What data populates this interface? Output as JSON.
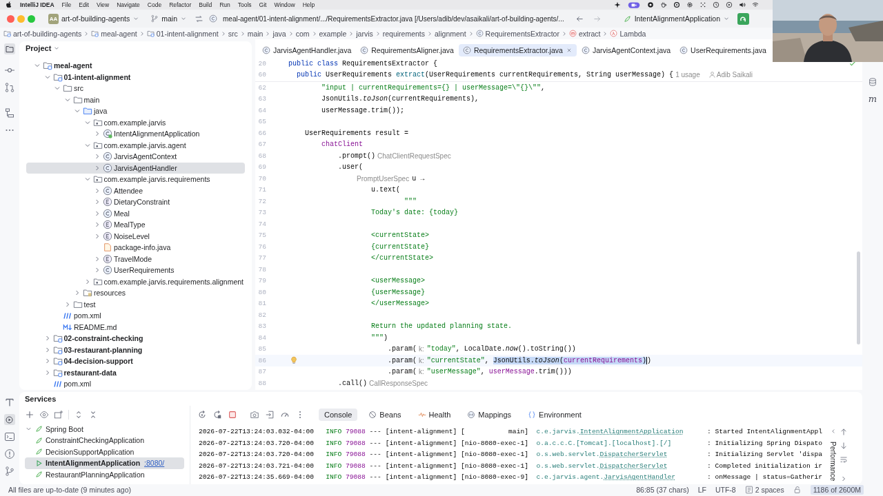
{
  "menubar": {
    "app": "IntelliJ IDEA",
    "menus": [
      "File",
      "Edit",
      "View",
      "Navigate",
      "Code",
      "Refactor",
      "Build",
      "Run",
      "Tools",
      "Git",
      "Window",
      "Help"
    ]
  },
  "titlebar": {
    "project_initials": "AA",
    "project": "art-of-building-agents",
    "branch": "main",
    "title": "meal-agent/01-intent-alignment/.../RequirementsExtractor.java [/Users/adib/dev/asaikali/art-of-building-agents/...",
    "run_config": "IntentAlignmentApplication"
  },
  "breadcrumbs": [
    {
      "label": "art-of-building-agents",
      "kind": "module"
    },
    {
      "label": "meal-agent",
      "kind": "module"
    },
    {
      "label": "01-intent-alignment",
      "kind": "module"
    },
    {
      "label": "src",
      "kind": "plain"
    },
    {
      "label": "main",
      "kind": "plain"
    },
    {
      "label": "java",
      "kind": "plain"
    },
    {
      "label": "com",
      "kind": "plain"
    },
    {
      "label": "example",
      "kind": "plain"
    },
    {
      "label": "jarvis",
      "kind": "plain"
    },
    {
      "label": "requirements",
      "kind": "plain"
    },
    {
      "label": "alignment",
      "kind": "plain"
    },
    {
      "label": "RequirementsExtractor",
      "kind": "class"
    },
    {
      "label": "extract",
      "kind": "method"
    },
    {
      "label": "Lambda",
      "kind": "lambda"
    }
  ],
  "project": {
    "title": "Project",
    "tree": [
      {
        "label": "meal-agent",
        "kind": "module",
        "expanded": true,
        "selected": false,
        "children": [
          {
            "label": "01-intent-alignment",
            "kind": "module",
            "expanded": true,
            "selected": false,
            "children": [
              {
                "label": "src",
                "kind": "folder",
                "expanded": true,
                "selected": false,
                "children": [
                  {
                    "label": "main",
                    "kind": "folder",
                    "expanded": true,
                    "selected": false,
                    "children": [
                      {
                        "label": "java",
                        "kind": "source",
                        "expanded": true,
                        "selected": false,
                        "children": [
                          {
                            "label": "com.example.jarvis",
                            "kind": "package",
                            "expanded": true,
                            "selected": false,
                            "children": [
                              {
                                "label": "IntentAlignmentApplication",
                                "kind": "spring",
                                "expanded": false,
                                "selected": false
                              }
                            ]
                          },
                          {
                            "label": "com.example.jarvis.agent",
                            "kind": "package",
                            "expanded": true,
                            "selected": false,
                            "children": [
                              {
                                "label": "JarvisAgentContext",
                                "kind": "class",
                                "expanded": false,
                                "selected": false
                              },
                              {
                                "label": "JarvisAgentHandler",
                                "kind": "class",
                                "expanded": false,
                                "selected": true
                              }
                            ]
                          },
                          {
                            "label": "com.example.jarvis.requirements",
                            "kind": "package",
                            "expanded": true,
                            "selected": false,
                            "children": [
                              {
                                "label": "Attendee",
                                "kind": "class",
                                "expanded": false,
                                "selected": false
                              },
                              {
                                "label": "DietaryConstraint",
                                "kind": "enum",
                                "expanded": false,
                                "selected": false
                              },
                              {
                                "label": "Meal",
                                "kind": "class",
                                "expanded": false,
                                "selected": false
                              },
                              {
                                "label": "MealType",
                                "kind": "enum",
                                "expanded": false,
                                "selected": false
                              },
                              {
                                "label": "NoiseLevel",
                                "kind": "enum",
                                "expanded": false,
                                "selected": false
                              },
                              {
                                "label": "package-info.java",
                                "kind": "javafile",
                                "selected": false
                              },
                              {
                                "label": "TravelMode",
                                "kind": "enum",
                                "expanded": false,
                                "selected": false
                              },
                              {
                                "label": "UserRequirements",
                                "kind": "class",
                                "expanded": false,
                                "selected": false
                              }
                            ]
                          },
                          {
                            "label": "com.example.jarvis.requirements.alignment",
                            "kind": "package",
                            "expanded": false,
                            "selected": false
                          }
                        ]
                      },
                      {
                        "label": "resources",
                        "kind": "resources",
                        "expanded": false,
                        "selected": false
                      }
                    ]
                  },
                  {
                    "label": "test",
                    "kind": "folder",
                    "expanded": false,
                    "selected": false
                  }
                ]
              },
              {
                "label": "pom.xml",
                "kind": "maven",
                "selected": false
              },
              {
                "label": "README.md",
                "kind": "markdown",
                "selected": false
              }
            ]
          },
          {
            "label": "02-constraint-checking",
            "kind": "module",
            "expanded": false,
            "selected": false
          },
          {
            "label": "03-restaurant-planning",
            "kind": "module",
            "expanded": false,
            "selected": false
          },
          {
            "label": "04-decision-support",
            "kind": "module",
            "expanded": false,
            "selected": false
          },
          {
            "label": "restaurant-data",
            "kind": "module",
            "expanded": false,
            "selected": false
          },
          {
            "label": "pom.xml",
            "kind": "maven",
            "selected": false
          }
        ]
      }
    ]
  },
  "editor": {
    "tabs": [
      {
        "label": "JarvisAgentHandler.java",
        "selected": false
      },
      {
        "label": "RequirementsAligner.java",
        "selected": false
      },
      {
        "label": "RequirementsExtractor.java",
        "selected": true
      },
      {
        "label": "JarvisAgentContext.java",
        "selected": false
      },
      {
        "label": "UserRequirements.java",
        "selected": false
      }
    ],
    "sticky_lines": [
      {
        "number": "20",
        "current": false,
        "tokens": [
          {
            "text": "public class ",
            "kind": "keyword"
          },
          {
            "text": "RequirementsExtractor {",
            "kind": "plain"
          }
        ]
      },
      {
        "number": "60",
        "current": false,
        "tokens": [
          {
            "text": "  public ",
            "kind": "keyword"
          },
          {
            "text": "UserRequirements ",
            "kind": "plain"
          },
          {
            "text": "extract",
            "kind": "declaration"
          },
          {
            "text": "(UserRequirements currentRequirements, String userMessage) {",
            "kind": "plain"
          },
          {
            "text": "1 usage",
            "kind": "hint"
          },
          {
            "text": "Adib Saikali",
            "kind": "author"
          }
        ]
      }
    ],
    "lines": [
      {
        "number": "62",
        "current": false,
        "tokens": [
          {
            "text": "        \"input | currentRequirements={} | userMessage=\\\"{}\\\"\"",
            "kind": "string"
          },
          {
            "text": ",",
            "kind": "plain"
          }
        ]
      },
      {
        "number": "63",
        "current": false,
        "tokens": [
          {
            "text": "        JsonUtils.",
            "kind": "plain"
          },
          {
            "text": "toJson",
            "kind": "method"
          },
          {
            "text": "(currentRequirements),",
            "kind": "plain"
          }
        ]
      },
      {
        "number": "64",
        "current": false,
        "tokens": [
          {
            "text": "        userMessage.trim());",
            "kind": "plain"
          }
        ]
      },
      {
        "number": "65",
        "current": false
      },
      {
        "number": "66",
        "current": false,
        "tokens": [
          {
            "text": "    UserRequirements result =",
            "kind": "plain"
          }
        ]
      },
      {
        "number": "67",
        "current": false,
        "tokens": [
          {
            "text": "        chatClient",
            "kind": "field"
          }
        ]
      },
      {
        "number": "68",
        "current": false,
        "tokens": [
          {
            "text": "            .prompt()",
            "kind": "plain"
          },
          {
            "text": "ChatClientRequestSpec",
            "kind": "hint"
          }
        ]
      },
      {
        "number": "69",
        "current": false,
        "tokens": [
          {
            "text": "            .user(",
            "kind": "plain"
          }
        ]
      },
      {
        "number": "70",
        "current": false,
        "tokens": [
          {
            "text": "                PromptUserSpec",
            "kind": "hint"
          },
          {
            "text": "u →",
            "kind": "plain"
          }
        ]
      },
      {
        "number": "71",
        "current": false,
        "tokens": [
          {
            "text": "                    u.text(",
            "kind": "plain"
          }
        ]
      },
      {
        "number": "72",
        "current": false,
        "tokens": [
          {
            "text": "                            \"\"\"",
            "kind": "string"
          }
        ]
      },
      {
        "number": "73",
        "current": false,
        "tokens": [
          {
            "text": "                    Today's date: {today}",
            "kind": "string"
          }
        ]
      },
      {
        "number": "74",
        "current": false
      },
      {
        "number": "75",
        "current": false,
        "tokens": [
          {
            "text": "                    <currentState>",
            "kind": "string"
          }
        ]
      },
      {
        "number": "76",
        "current": false,
        "tokens": [
          {
            "text": "                    {currentState}",
            "kind": "string"
          }
        ]
      },
      {
        "number": "77",
        "current": false,
        "tokens": [
          {
            "text": "                    </currentState>",
            "kind": "string"
          }
        ]
      },
      {
        "number": "78",
        "current": false
      },
      {
        "number": "79",
        "current": false,
        "tokens": [
          {
            "text": "                    <userMessage>",
            "kind": "string"
          }
        ]
      },
      {
        "number": "80",
        "current": false,
        "tokens": [
          {
            "text": "                    {userMessage}",
            "kind": "string"
          }
        ]
      },
      {
        "number": "81",
        "current": false,
        "tokens": [
          {
            "text": "                    </userMessage>",
            "kind": "string"
          }
        ]
      },
      {
        "number": "82",
        "current": false
      },
      {
        "number": "83",
        "current": false,
        "tokens": [
          {
            "text": "                    Return the updated planning state.",
            "kind": "string"
          }
        ]
      },
      {
        "number": "84",
        "current": false,
        "tokens": [
          {
            "text": "                    \"\"\"",
            "kind": "string"
          },
          {
            "text": ")",
            "kind": "plain"
          }
        ]
      },
      {
        "number": "85",
        "current": false,
        "tokens": [
          {
            "text": "                        .param(",
            "kind": "plain"
          },
          {
            "text": "k:",
            "kind": "hint"
          },
          {
            "text": "\"today\"",
            "kind": "string"
          },
          {
            "text": ", LocalDate.",
            "kind": "plain"
          },
          {
            "text": "now",
            "kind": "method"
          },
          {
            "text": "().toString())",
            "kind": "plain"
          }
        ]
      },
      {
        "number": "86",
        "current": true,
        "tokens": [
          {
            "text": "                        .param(",
            "kind": "plain"
          },
          {
            "text": "k:",
            "kind": "hint"
          },
          {
            "text": "\"currentState\"",
            "kind": "string"
          },
          {
            "text": ", ",
            "kind": "plain"
          },
          {
            "text": "JsonUtils.",
            "kind": "selplain"
          },
          {
            "text": "toJson",
            "kind": "selmethod"
          },
          {
            "text": "(",
            "kind": "selplain"
          },
          {
            "text": "currentRequirements",
            "kind": "selfield"
          },
          {
            "text": ")",
            "kind": "selplain"
          },
          {
            "text": ")",
            "kind": "plain"
          }
        ]
      },
      {
        "number": "87",
        "current": false,
        "tokens": [
          {
            "text": "                        .param(",
            "kind": "plain"
          },
          {
            "text": "k:",
            "kind": "hint"
          },
          {
            "text": "\"userMessage\"",
            "kind": "string"
          },
          {
            "text": ", ",
            "kind": "plain"
          },
          {
            "text": "userMessage",
            "kind": "field"
          },
          {
            "text": ".trim()))",
            "kind": "plain"
          }
        ]
      },
      {
        "number": "88",
        "current": false,
        "tokens": [
          {
            "text": "            .call()",
            "kind": "plain"
          },
          {
            "text": "CallResponseSpec",
            "kind": "hint"
          }
        ]
      }
    ]
  },
  "right_strip": {
    "maven_label": "m"
  },
  "services": {
    "title": "Services",
    "tree": [
      {
        "label": "Spring Boot",
        "expanded": true,
        "selected": false,
        "children": [
          {
            "label": "ConstraintCheckingApplication",
            "running": false,
            "selected": false
          },
          {
            "label": "DecisionSupportApplication",
            "running": false,
            "selected": false
          },
          {
            "label": "IntentAlignmentApplication",
            "running": true,
            "selected": true,
            "link": ":8080/"
          },
          {
            "label": "RestaurantPlanningApplication",
            "running": false,
            "selected": false
          }
        ]
      }
    ],
    "tabs": [
      {
        "label": "Console",
        "kind": "console",
        "selected": true
      },
      {
        "label": "Beans",
        "kind": "beans",
        "selected": false
      },
      {
        "label": "Health",
        "kind": "health",
        "selected": false
      },
      {
        "label": "Mappings",
        "kind": "mappings",
        "selected": false
      },
      {
        "label": "Environment",
        "kind": "environment",
        "selected": false
      }
    ],
    "log": [
      {
        "timestamp": "2026-07-22T13:24:03.032-04:00",
        "level": "INFO",
        "pid": "79088",
        "separator": "---",
        "app": "[intent-alignment]",
        "thread": "[           main]",
        "logger_package": "c.e.jarvis.",
        "logger_class": "IntentAlignmentApplication",
        "message": ": Started IntentAlignmentAppl"
      },
      {
        "timestamp": "2026-07-22T13:24:03.720-04:00",
        "level": "INFO",
        "pid": "79088",
        "separator": "---",
        "app": "[intent-alignment]",
        "thread": "[nio-8080-exec-1]",
        "logger_package": "o.a.c.c.C.[Tomcat].[localhost].[/]",
        "message": ": Initializing Spring Dispato"
      },
      {
        "timestamp": "2026-07-22T13:24:03.720-04:00",
        "level": "INFO",
        "pid": "79088",
        "separator": "---",
        "app": "[intent-alignment]",
        "thread": "[nio-8080-exec-1]",
        "logger_package": "o.s.web.servlet.",
        "logger_class": "DispatcherServlet",
        "message": ": Initializing Servlet 'dispa"
      },
      {
        "timestamp": "2026-07-22T13:24:03.721-04:00",
        "level": "INFO",
        "pid": "79088",
        "separator": "---",
        "app": "[intent-alignment]",
        "thread": "[nio-8080-exec-1]",
        "logger_package": "o.s.web.servlet.",
        "logger_class": "DispatcherServlet",
        "message": ": Completed initialization ir"
      },
      {
        "timestamp": "2026-07-22T13:24:35.669-04:00",
        "level": "INFO",
        "pid": "79088",
        "separator": "---",
        "app": "[intent-alignment]",
        "thread": "[nio-8080-exec-9]",
        "logger_package": "c.e.jarvis.agent.",
        "logger_class": "JarvisAgentHandler",
        "message": ": onMessage | status=Gatherir"
      }
    ],
    "side_label": "Performance"
  },
  "statusbar": {
    "message": "All files are up-to-date (9 minutes ago)",
    "position": "86:85 (37 chars)",
    "line_separator": "LF",
    "encoding": "UTF-8",
    "indent": "2 spaces",
    "memory": "1186 of 2600M"
  }
}
